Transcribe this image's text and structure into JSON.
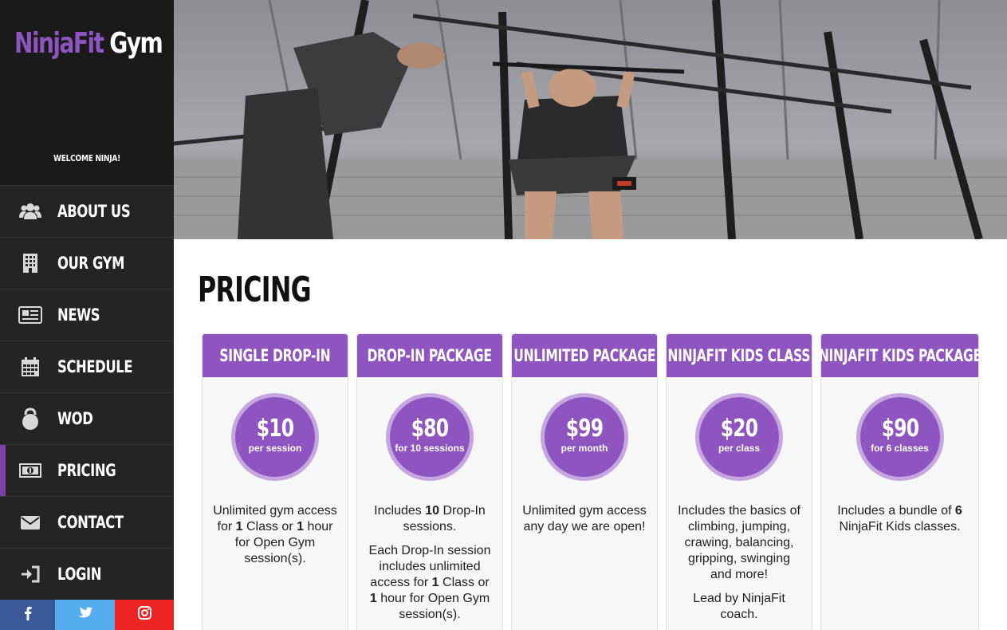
{
  "brand": {
    "ninja": "Ninja",
    "fit": "Fit",
    "gym": "Gym",
    "welcome": "WELCOME NINJA!"
  },
  "nav": [
    {
      "label": "ABOUT US",
      "icon": "users-icon"
    },
    {
      "label": "OUR GYM",
      "icon": "building-icon"
    },
    {
      "label": "NEWS",
      "icon": "newspaper-icon"
    },
    {
      "label": "SCHEDULE",
      "icon": "calendar-icon"
    },
    {
      "label": "WOD",
      "icon": "kettlebell-icon"
    },
    {
      "label": "PRICING",
      "icon": "money-icon",
      "active": true
    },
    {
      "label": "CONTACT",
      "icon": "envelope-icon"
    },
    {
      "label": "LOGIN",
      "icon": "sign-in-icon"
    }
  ],
  "social": [
    {
      "icon": "facebook-icon",
      "color": "#3b5998"
    },
    {
      "icon": "twitter-icon",
      "color": "#55acee"
    },
    {
      "icon": "instagram-icon",
      "color": "#ee2424"
    }
  ],
  "page": {
    "title": "PRICING"
  },
  "colors": {
    "accent": "#8e55c1",
    "accent_light": "#c6a6e0",
    "sidebar": "#242424",
    "active_bar": "#7d3fa8"
  },
  "cards": [
    {
      "title": "SINGLE DROP-IN",
      "price": "$10",
      "per": "per session",
      "desc": [
        [
          "Unlimited gym access for ",
          "1",
          " Class or ",
          "1",
          " hour for Open Gym session(s)."
        ]
      ]
    },
    {
      "title": "DROP-IN PACKAGE",
      "price": "$80",
      "per": "for 10 sessions",
      "desc": [
        [
          "Includes ",
          "10",
          " Drop-In sessions."
        ],
        [
          "Each Drop-In session includes unlimited access for ",
          "1",
          " Class or ",
          "1",
          " hour for Open Gym session(s)."
        ]
      ]
    },
    {
      "title": "UNLIMITED PACKAGE",
      "price": "$99",
      "per": "per month",
      "desc": [
        [
          "Unlimited gym access any day we are open!"
        ]
      ]
    },
    {
      "title": "NINJAFIT KIDS CLASS",
      "price": "$20",
      "per": "per class",
      "desc": [
        [
          "Includes the basics of climbing, jumping, crawing, balancing, gripping, swinging and more!"
        ],
        [
          "Lead by NinjaFit coach."
        ]
      ]
    },
    {
      "title": "NINJAFIT KIDS PACKAGE",
      "price": "$90",
      "per": "for 6 classes",
      "desc": [
        [
          "Includes a bundle of ",
          "6",
          " NinjaFit Kids classes."
        ]
      ]
    }
  ]
}
